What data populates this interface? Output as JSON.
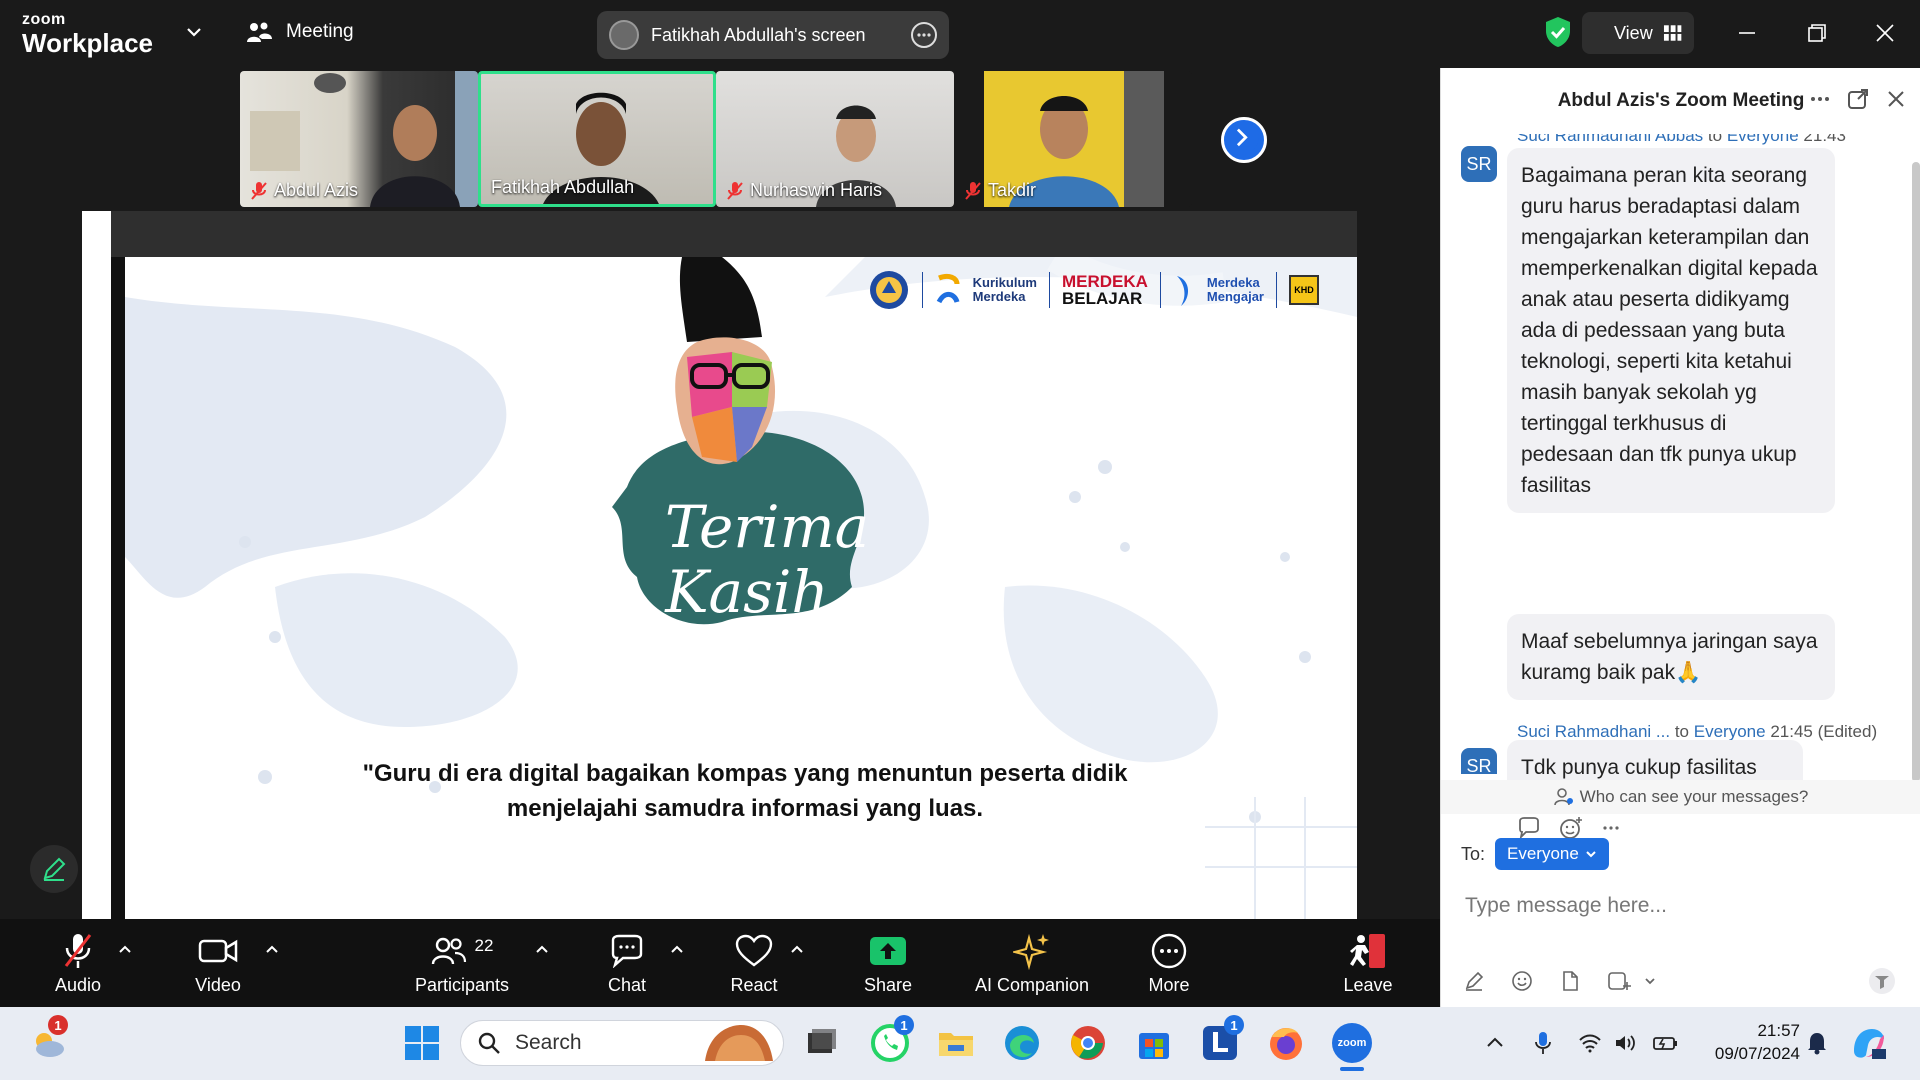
{
  "topbar": {
    "logo_top": "zoom",
    "logo_bottom": "Workplace",
    "meeting_label": "Meeting",
    "screen_label": "Fatikhah Abdullah's screen",
    "view_label": "View"
  },
  "participants": [
    {
      "name": "Abdul Azis"
    },
    {
      "name": "Fatikhah Abdullah"
    },
    {
      "name": "Nurhaswin Haris"
    },
    {
      "name": "Takdir"
    }
  ],
  "slide": {
    "logo_kurikulum_1": "Kurikulum",
    "logo_kurikulum_2": "Merdeka",
    "logo_merdeka_1": "MERDEKA",
    "logo_merdeka_2": "BELAJAR",
    "logo_mengajar_1": "Merdeka",
    "logo_mengajar_2": "Mengajar",
    "logo_khd": "KHD",
    "title_1": "Terima",
    "title_2": "Kasih",
    "quote_1": "\"Guru di era digital bagaikan kompas yang menuntun peserta didik",
    "quote_2": "menjelajahi samudra informasi yang luas."
  },
  "toolbar": {
    "audio": "Audio",
    "video": "Video",
    "participants": "Participants",
    "participants_count": "22",
    "chat": "Chat",
    "react": "React",
    "share": "Share",
    "ai": "AI Companion",
    "more": "More",
    "leave": "Leave"
  },
  "chat": {
    "title": "Abdul Azis's Zoom Meeting",
    "top_meta_sender": "Suci Rahmadhani Abbas",
    "top_meta_to": "to",
    "top_meta_audience": "Everyone",
    "top_meta_time": "21:43",
    "avatar_initials": "SR",
    "message_1": "Bagaimana peran kita seorang guru harus beradaptasi dalam mengajarkan keterampilan dan memperkenalkan digital kepada anak atau peserta didikyamg ada di pedessaan yang buta teknologi, seperti kita ketahui masih banyak sekolah yg tertinggal terkhusus di pedesaan dan tfk punya ukup fasilitas",
    "message_2": "Maaf sebelumnya jaringan saya kuramg baik pak🙏",
    "meta2_sender": "Suci Rahmadhani ...",
    "meta2_to": "to",
    "meta2_audience": "Everyone",
    "meta2_time": "21:45 (Edited)",
    "message_3": "Tdk punya cukup fasilitas",
    "who_can_see": "Who can see your messages?",
    "to_label": "To:",
    "to_value": "Everyone",
    "input_placeholder": "Type message here..."
  },
  "taskbar": {
    "search_label": "Search",
    "weather_badge": "1",
    "whatsapp_badge": "1",
    "l_app_badge": "1",
    "time": "21:57",
    "date": "09/07/2024",
    "zoom_label": "zoom"
  },
  "colors": {
    "accent_blue": "#1f6fe0",
    "active_green": "#2fdf8b",
    "share_green": "#19c36a",
    "leave_red": "#e0323a",
    "teal": "#2f6b68"
  }
}
